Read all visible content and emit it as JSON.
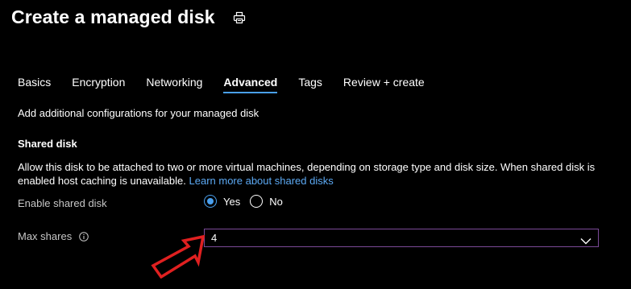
{
  "header": {
    "title": "Create a managed disk",
    "print_icon": "print-icon"
  },
  "tabs": [
    {
      "label": "Basics",
      "active": false
    },
    {
      "label": "Encryption",
      "active": false
    },
    {
      "label": "Networking",
      "active": false
    },
    {
      "label": "Advanced",
      "active": true
    },
    {
      "label": "Tags",
      "active": false
    },
    {
      "label": "Review + create",
      "active": false
    }
  ],
  "intro": "Add additional configurations for your managed disk",
  "shared_disk": {
    "heading": "Shared disk",
    "description": "Allow this disk to be attached to two or more virtual machines, depending on storage type and disk size. When shared disk is enabled host caching is unavailable.",
    "link_text": "Learn more about shared disks",
    "enable_label": "Enable shared disk",
    "options": [
      {
        "label": "Yes",
        "selected": true
      },
      {
        "label": "No",
        "selected": false
      }
    ],
    "max_shares_label": "Max shares",
    "max_shares_value": "4"
  },
  "colors": {
    "background": "#000000",
    "accent": "#4aa0ee",
    "link": "#5ca9f3",
    "focus_border": "#7b4a98",
    "annotation_arrow": "#e02020"
  },
  "icons": {
    "print": "print-icon",
    "info": "info-icon",
    "dropdown": "chevron-down-icon",
    "annotation": "red-arrow-icon"
  }
}
